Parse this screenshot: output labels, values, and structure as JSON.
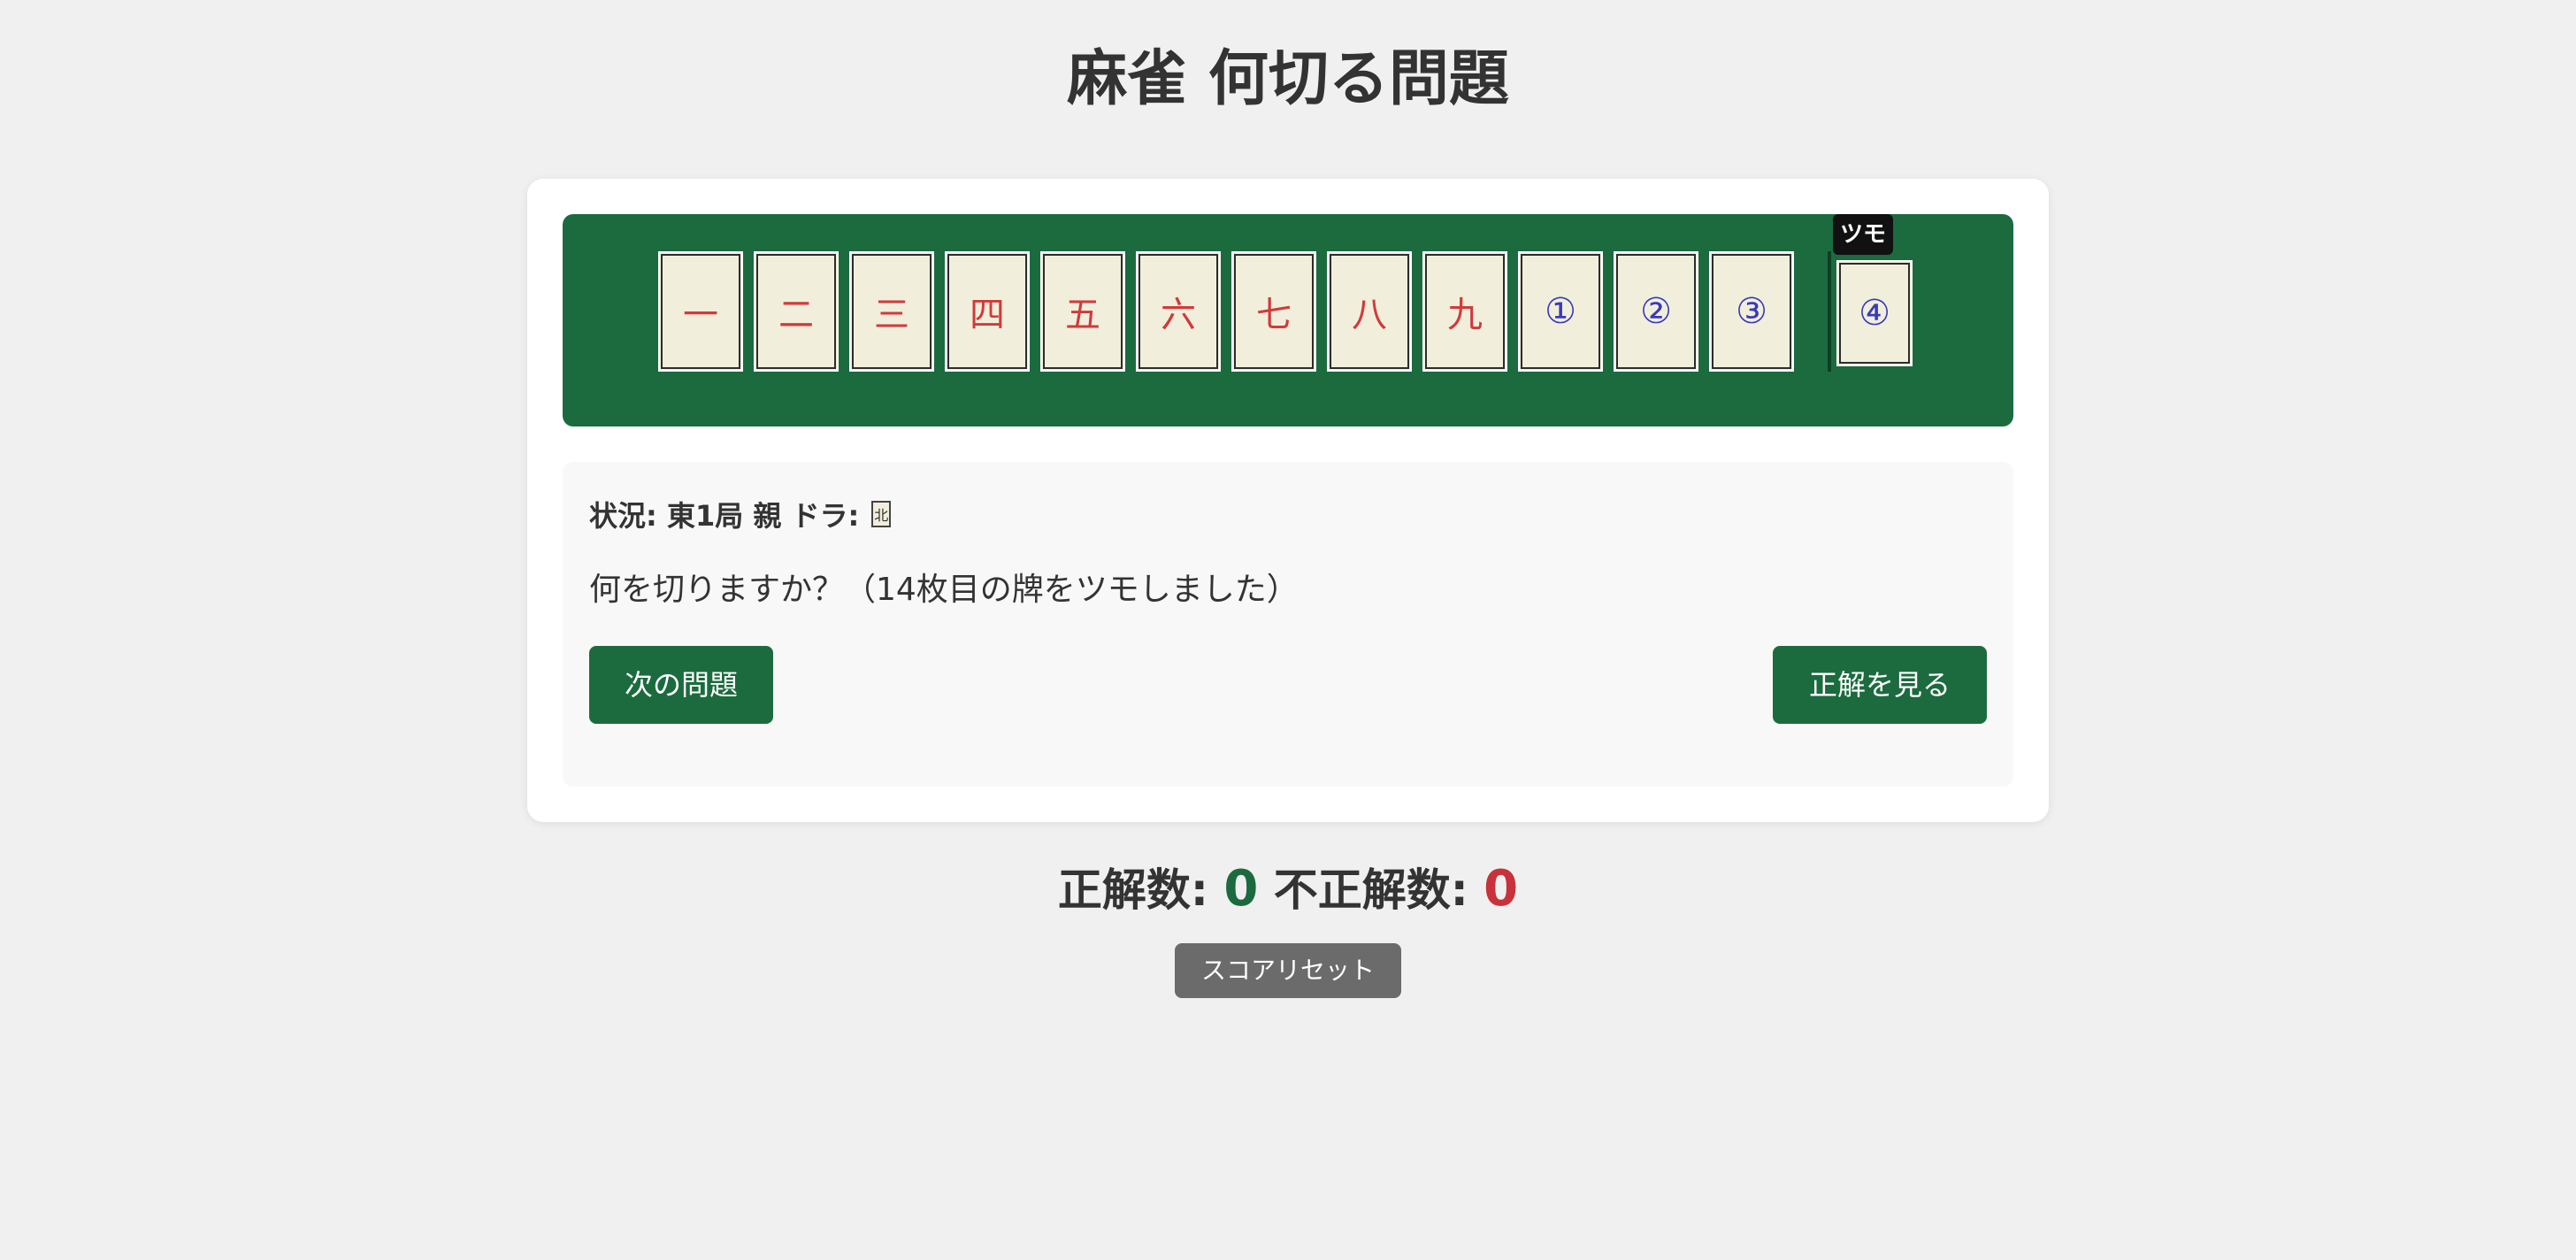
{
  "page": {
    "title": "麻雀 何切る問題"
  },
  "hand": {
    "tiles": [
      {
        "label": "一",
        "suit": "man"
      },
      {
        "label": "二",
        "suit": "man"
      },
      {
        "label": "三",
        "suit": "man"
      },
      {
        "label": "四",
        "suit": "man"
      },
      {
        "label": "五",
        "suit": "man"
      },
      {
        "label": "六",
        "suit": "man"
      },
      {
        "label": "七",
        "suit": "man"
      },
      {
        "label": "八",
        "suit": "man"
      },
      {
        "label": "九",
        "suit": "man"
      },
      {
        "label": "①",
        "suit": "pin"
      },
      {
        "label": "②",
        "suit": "pin"
      },
      {
        "label": "③",
        "suit": "pin"
      }
    ],
    "tsumo_tile": {
      "label": "④",
      "suit": "pin"
    },
    "tsumo_label": "ツモ"
  },
  "colors": {
    "table_green": "#1b6b3f",
    "man_red": "#d23a3a",
    "pin_blue": "#3a3ab8",
    "correct_green": "#1b6b3f",
    "wrong_red": "#c8323a"
  },
  "situation": {
    "text": "状況: 東1局 親 ドラ:",
    "dora_tile": "北"
  },
  "question": {
    "text": "何を切りますか？（14枚目の牌をツモしました）"
  },
  "buttons": {
    "next_label": "次の問題",
    "answer_label": "正解を見る",
    "reset_label": "スコアリセット"
  },
  "score": {
    "correct_label": "正解数:",
    "correct_value": "0",
    "wrong_label": "不正解数:",
    "wrong_value": "0"
  }
}
